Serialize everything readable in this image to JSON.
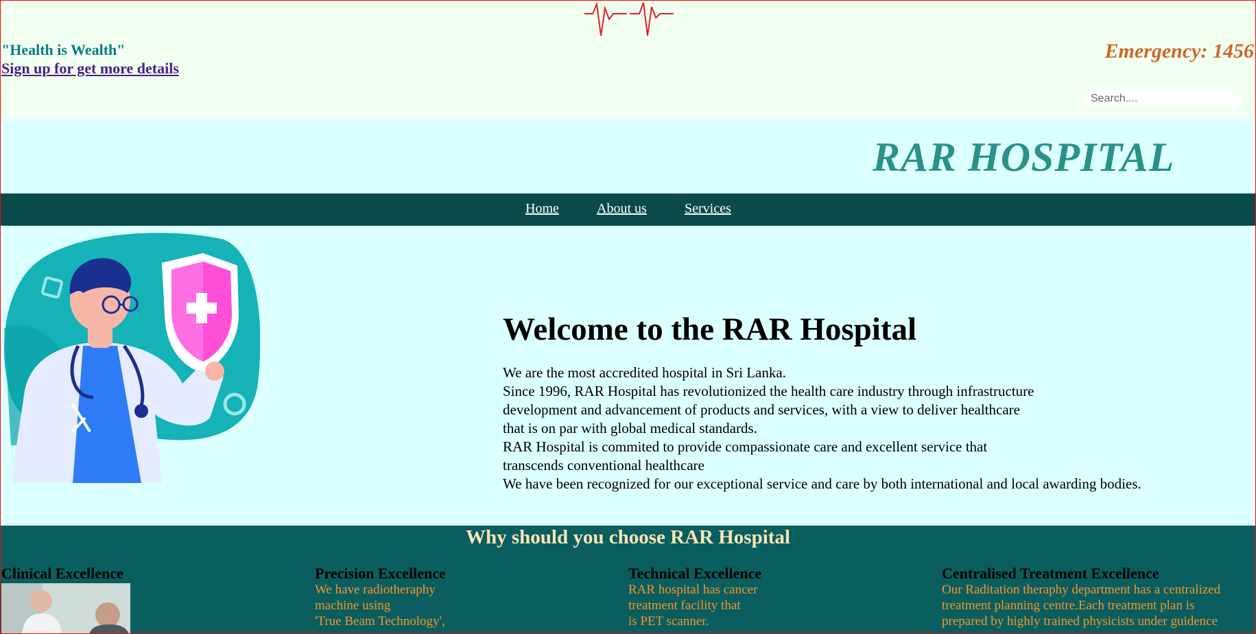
{
  "header": {
    "tagline": "\"Health is Wealth\"",
    "signup_link": "Sign up for get more details",
    "emergency": "Emergency: 1456",
    "search_placeholder": "Search....",
    "ecg_icon": "heartbeat-line-icon"
  },
  "brand": {
    "title": "RAR HOSPITAL"
  },
  "nav": {
    "items": [
      "Home",
      "About us",
      "Services"
    ]
  },
  "hero": {
    "illustration": "doctor-with-shield-illustration",
    "heading": "Welcome to the RAR Hospital",
    "lines": [
      "We are the most accredited hospital in Sri Lanka.",
      "Since 1996, RAR Hospital has revolutionized the health care industry through infrastructure",
      "development and advancement of products and services, with a view to deliver healthcare",
      "that is on par with global medical standards.",
      "RAR Hospital is commited to provide compassionate care and excellent service that",
      "transcends conventional healthcare",
      "We have been recognized for our exceptional service and care by both international and local awarding bodies."
    ]
  },
  "why": {
    "title": "Why should you choose RAR Hospital",
    "columns": [
      {
        "heading": "Clinical Excellence",
        "lines": []
      },
      {
        "heading": "Precision Excellence",
        "lines": [
          "We have radiotheraphy",
          "machine using",
          "'True Beam Technology',"
        ]
      },
      {
        "heading": "Technical Excellence",
        "lines": [
          "RAR hospital has cancer",
          "treatment facility that",
          "is PET scanner."
        ]
      },
      {
        "heading": "Centralised Treatment Excellence",
        "lines": [
          "Our Raditation theraphy department has a centralized",
          "treatment planning centre.Each treatment plan is",
          "prepared by highly trained physicists under guidence"
        ]
      }
    ]
  },
  "colors": {
    "nav_bg": "#0b4a4b",
    "hero_bg": "#dcffff",
    "brand": "#2a9189",
    "emergency": "#d0652a",
    "why_bg": "#0b5e5f",
    "why_text": "#f2932a"
  }
}
